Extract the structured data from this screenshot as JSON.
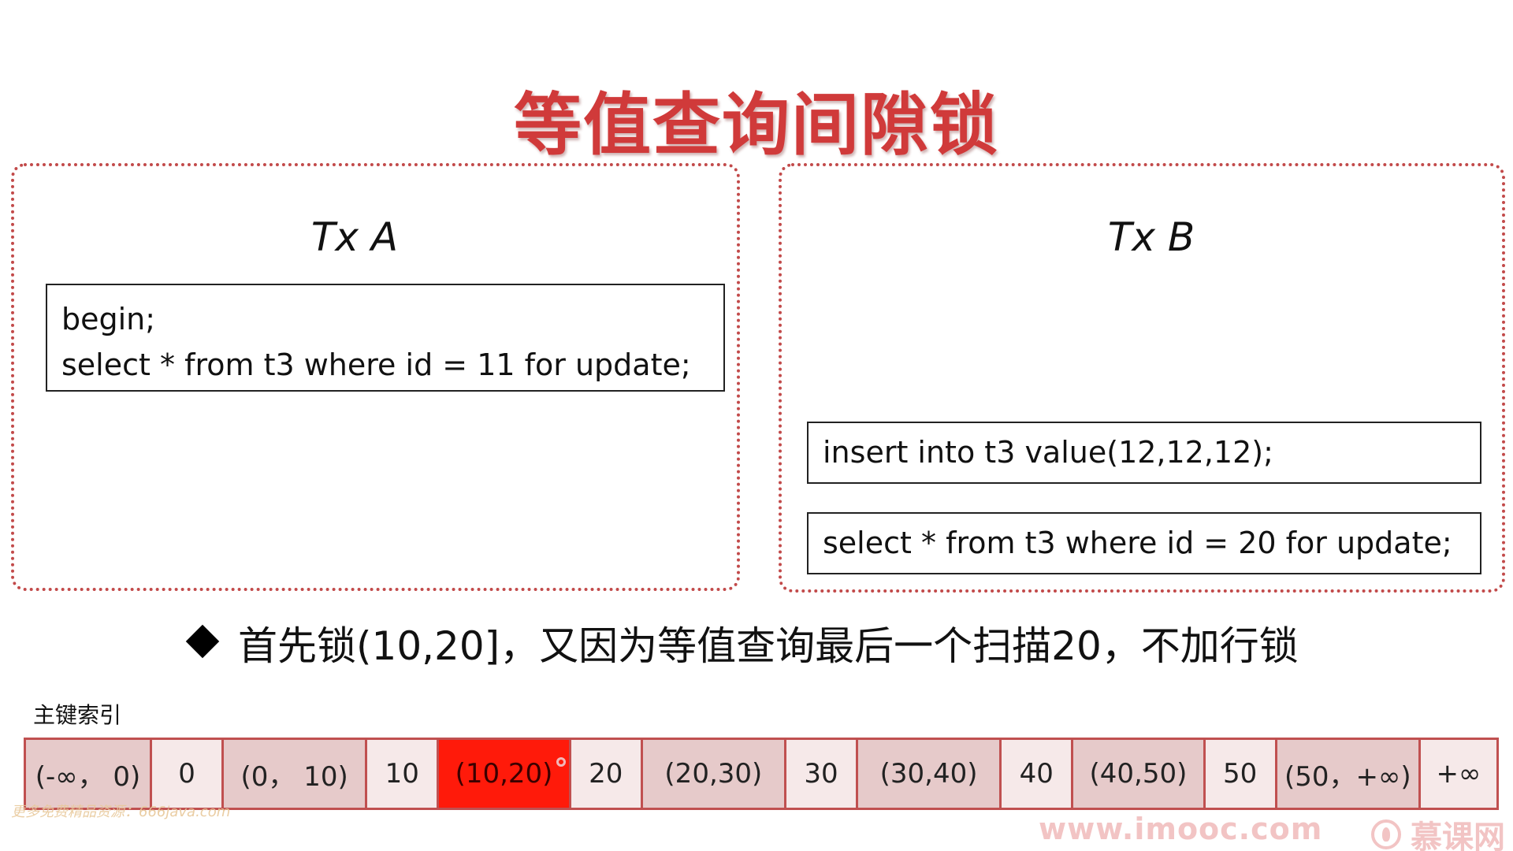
{
  "title": "等值查询间隙锁",
  "tx_a": {
    "label": "Tx A",
    "lines": [
      "begin;",
      "select * from t3 where id = 11 for update;"
    ]
  },
  "tx_b": {
    "label": "Tx B",
    "statements": [
      "insert into t3 value(12,12,12);",
      "select * from t3 where id = 20 for update;"
    ]
  },
  "bullet": "首先锁(10,20]，又因为等值查询最后一个扫描20，不加行锁",
  "index": {
    "label": "主键索引",
    "cells": [
      {
        "text": "(-∞， 0)",
        "kind": "gap"
      },
      {
        "text": "0",
        "kind": "record"
      },
      {
        "text": "(0， 10)",
        "kind": "gap"
      },
      {
        "text": "10",
        "kind": "record"
      },
      {
        "text": "(10,20)",
        "kind": "gap",
        "highlighted": true
      },
      {
        "text": "20",
        "kind": "record"
      },
      {
        "text": "(20,30)",
        "kind": "gap"
      },
      {
        "text": "30",
        "kind": "record"
      },
      {
        "text": "(30,40)",
        "kind": "gap"
      },
      {
        "text": "40",
        "kind": "record"
      },
      {
        "text": "(40,50)",
        "kind": "gap"
      },
      {
        "text": "50",
        "kind": "record"
      },
      {
        "text": "(50，+∞)",
        "kind": "gap"
      },
      {
        "text": "+∞",
        "kind": "record"
      }
    ]
  },
  "watermark_left": "更多免费精品资源：666java.com",
  "watermark_right": "www.imooc.com",
  "logo_text": "慕课网",
  "colors": {
    "title": "#d03a3a",
    "panel_border": "#c24a4a",
    "gap_cell": "#e6caca",
    "record_cell": "#f6e9e9",
    "highlight_cell": "#ff1a0a"
  }
}
